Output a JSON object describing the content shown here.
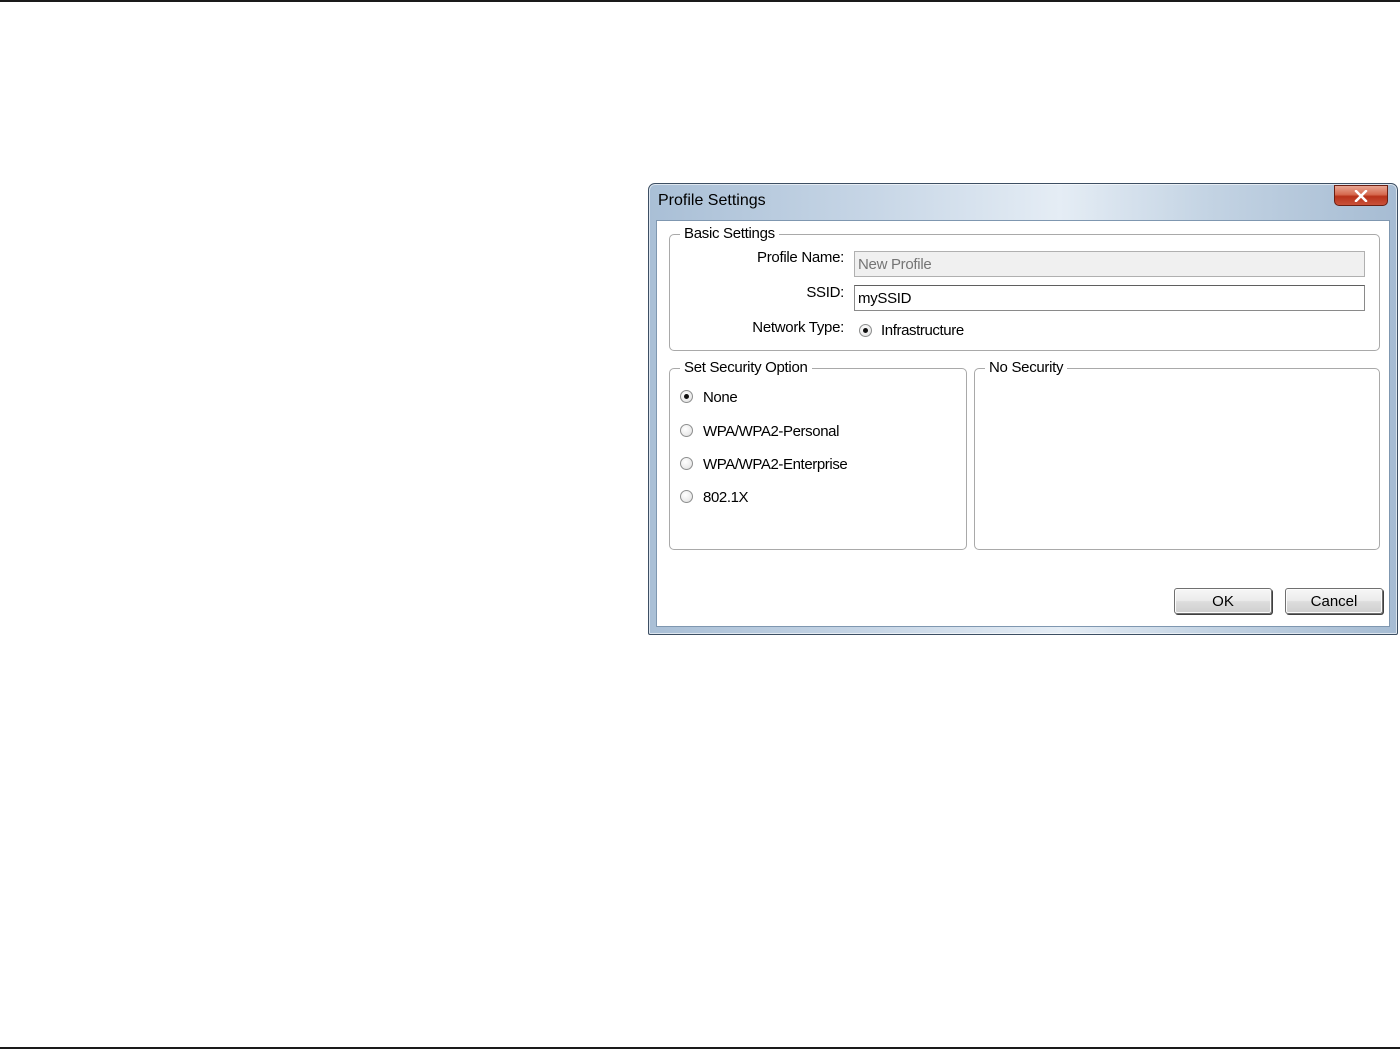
{
  "window": {
    "title": "Profile Settings"
  },
  "basic_settings": {
    "legend": "Basic Settings",
    "profile_name_label": "Profile Name:",
    "profile_name_placeholder": "New Profile",
    "profile_name_value": "",
    "ssid_label": "SSID:",
    "ssid_value": "mySSID",
    "network_type_label": "Network Type:",
    "network_type_option": "Infrastructure"
  },
  "security_option": {
    "legend": "Set Security Option",
    "options": [
      {
        "label": "None",
        "checked": true
      },
      {
        "label": "WPA/WPA2-Personal",
        "checked": false
      },
      {
        "label": "WPA/WPA2-Enterprise",
        "checked": false
      },
      {
        "label": "802.1X",
        "checked": false
      }
    ]
  },
  "security_detail": {
    "legend": "No Security"
  },
  "buttons": {
    "ok": "OK",
    "cancel": "Cancel"
  },
  "icons": {
    "close": "close-icon"
  },
  "colors": {
    "close_button": "#c9523a",
    "titlebar": "#c7d6e6"
  }
}
